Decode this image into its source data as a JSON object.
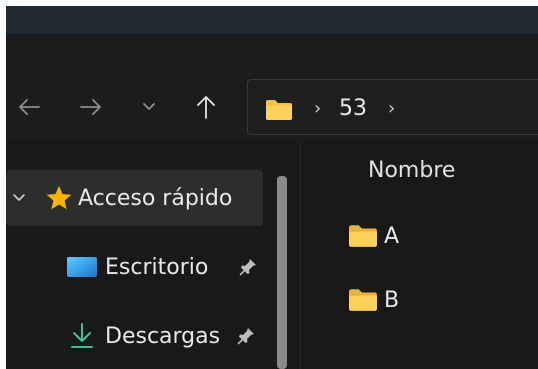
{
  "address": {
    "crumbs": [
      "53"
    ]
  },
  "sidebar": {
    "items": [
      {
        "label": "Acceso rápido",
        "icon": "star-icon"
      },
      {
        "label": "Escritorio",
        "icon": "desktop-icon"
      },
      {
        "label": "Descargas",
        "icon": "download-icon"
      }
    ]
  },
  "content": {
    "column_header": "Nombre",
    "files": [
      {
        "name": "A",
        "icon": "folder-icon"
      },
      {
        "name": "B",
        "icon": "folder-icon"
      }
    ]
  },
  "colors": {
    "background": "#191919",
    "folder": "#f5c542",
    "star": "#f7b500",
    "download": "#3fbf8f",
    "desktop": "#36a3e8"
  }
}
